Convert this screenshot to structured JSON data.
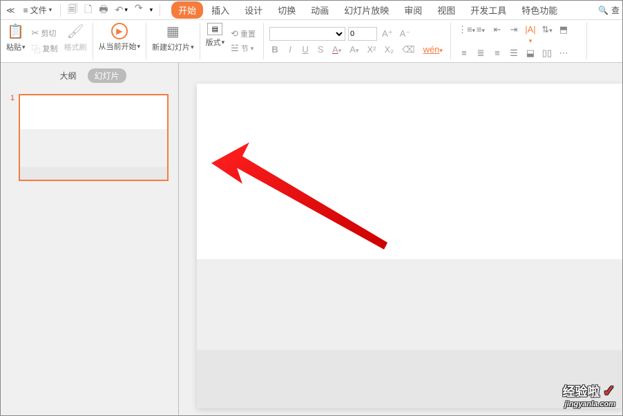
{
  "menu": {
    "file": "文件"
  },
  "tabs": {
    "start": "开始",
    "insert": "插入",
    "design": "设计",
    "transition": "切换",
    "animation": "动画",
    "slideshow": "幻灯片放映",
    "review": "审阅",
    "view": "视图",
    "devtools": "开发工具",
    "special": "特色功能"
  },
  "search": "查",
  "ribbon": {
    "paste": "粘贴",
    "cut": "剪切",
    "copy": "复制",
    "format_painter": "格式刷",
    "from_current": "从当前开始",
    "new_slide": "新建幻灯片",
    "layout": "版式",
    "reset": "重置",
    "section": "节",
    "font_size": "0"
  },
  "sidebar": {
    "outline": "大纲",
    "slides": "幻灯片",
    "thumb_num": "1"
  },
  "watermark": {
    "main": "经验啦",
    "sub": "jingyanla.com"
  }
}
